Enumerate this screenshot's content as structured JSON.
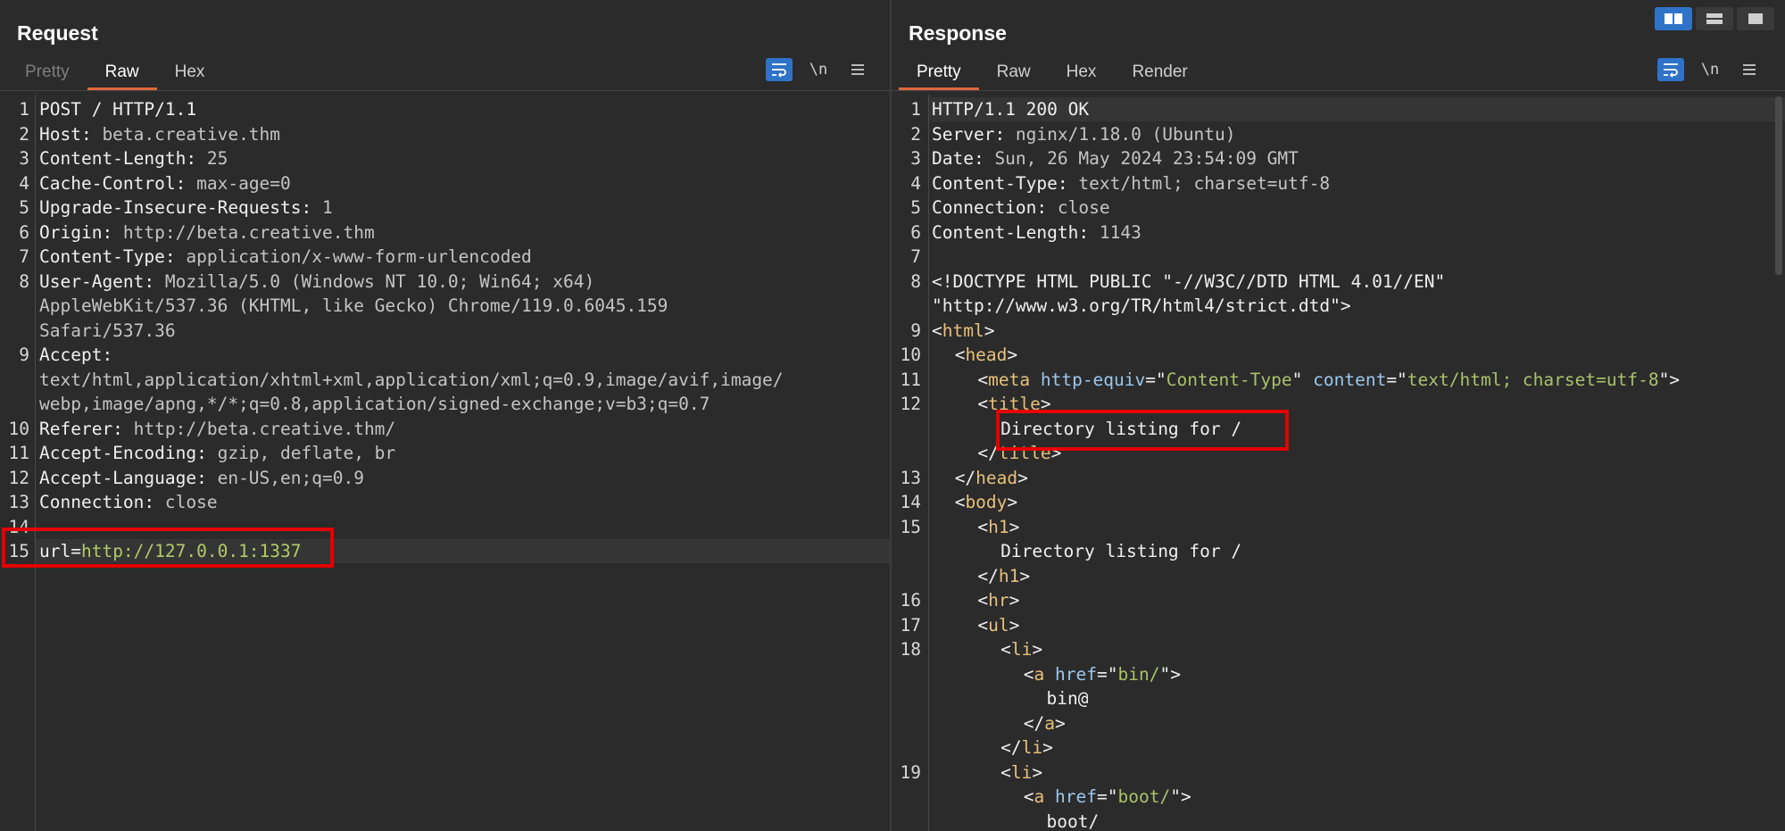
{
  "request": {
    "title": "Request",
    "tabs": [
      {
        "label": "Pretty",
        "state": "disabled"
      },
      {
        "label": "Raw",
        "state": "active"
      },
      {
        "label": "Hex",
        "state": "normal"
      }
    ],
    "tools": {
      "wrap_icon": "wrap-lines-icon",
      "newline_label": "\\n",
      "menu_icon": "hamburger-menu-icon"
    },
    "lines": [
      {
        "n": "1",
        "k": "POST / HTTP/1.1",
        "v": ""
      },
      {
        "n": "2",
        "k": "Host:",
        "v": " beta.creative.thm"
      },
      {
        "n": "3",
        "k": "Content-Length:",
        "v": " 25"
      },
      {
        "n": "4",
        "k": "Cache-Control:",
        "v": " max-age=0"
      },
      {
        "n": "5",
        "k": "Upgrade-Insecure-Requests:",
        "v": " 1"
      },
      {
        "n": "6",
        "k": "Origin:",
        "v": " http://beta.creative.thm"
      },
      {
        "n": "7",
        "k": "Content-Type:",
        "v": " application/x-www-form-urlencoded"
      },
      {
        "n": "8",
        "k": "User-Agent:",
        "v": " Mozilla/5.0 (Windows NT 10.0; Win64; x64)"
      },
      {
        "n": "",
        "k": "",
        "v": "AppleWebKit/537.36 (KHTML, like Gecko) Chrome/119.0.6045.159"
      },
      {
        "n": "",
        "k": "",
        "v": "Safari/537.36"
      },
      {
        "n": "9",
        "k": "Accept:",
        "v": ""
      },
      {
        "n": "",
        "k": "",
        "v": "text/html,application/xhtml+xml,application/xml;q=0.9,image/avif,image/"
      },
      {
        "n": "",
        "k": "",
        "v": "webp,image/apng,*/*;q=0.8,application/signed-exchange;v=b3;q=0.7"
      },
      {
        "n": "10",
        "k": "Referer:",
        "v": " http://beta.creative.thm/"
      },
      {
        "n": "11",
        "k": "Accept-Encoding:",
        "v": " gzip, deflate, br"
      },
      {
        "n": "12",
        "k": "Accept-Language:",
        "v": " en-US,en;q=0.9"
      },
      {
        "n": "13",
        "k": "Connection:",
        "v": " close"
      },
      {
        "n": "14",
        "k": "",
        "v": ""
      }
    ],
    "body_line": {
      "n": "15",
      "key": "url=",
      "value": "http://127.0.0.1:1337"
    }
  },
  "response": {
    "title": "Response",
    "tabs": [
      {
        "label": "Pretty",
        "state": "active"
      },
      {
        "label": "Raw",
        "state": "normal"
      },
      {
        "label": "Hex",
        "state": "normal"
      },
      {
        "label": "Render",
        "state": "normal"
      }
    ],
    "tools": {
      "wrap_icon": "wrap-lines-icon",
      "newline_label": "\\n",
      "menu_icon": "hamburger-menu-icon"
    },
    "layout_buttons": [
      "split-horizontal-icon",
      "split-vertical-icon",
      "single-pane-icon"
    ],
    "lines": [
      {
        "n": "1",
        "parts": [
          [
            "k",
            "HTTP/1.1 200 OK"
          ]
        ],
        "indent": 0
      },
      {
        "n": "2",
        "parts": [
          [
            "k",
            "Server:"
          ],
          [
            "v",
            " nginx/1.18.0 (Ubuntu)"
          ]
        ],
        "indent": 0
      },
      {
        "n": "3",
        "parts": [
          [
            "k",
            "Date:"
          ],
          [
            "v",
            " Sun, 26 May 2024 23:54:09 GMT"
          ]
        ],
        "indent": 0
      },
      {
        "n": "4",
        "parts": [
          [
            "k",
            "Content-Type:"
          ],
          [
            "v",
            " text/html; charset=utf-8"
          ]
        ],
        "indent": 0
      },
      {
        "n": "5",
        "parts": [
          [
            "k",
            "Connection:"
          ],
          [
            "v",
            " close"
          ]
        ],
        "indent": 0
      },
      {
        "n": "6",
        "parts": [
          [
            "k",
            "Content-Length:"
          ],
          [
            "v",
            " 1143"
          ]
        ],
        "indent": 0
      },
      {
        "n": "7",
        "parts": [],
        "indent": 0
      },
      {
        "n": "8",
        "parts": [
          [
            "k",
            "<!DOCTYPE HTML PUBLIC \"-//W3C//DTD HTML 4.01//EN\""
          ]
        ],
        "indent": 0
      },
      {
        "n": "",
        "parts": [
          [
            "k",
            "\"http://www.w3.org/TR/html4/strict.dtd\">"
          ]
        ],
        "indent": 0
      },
      {
        "n": "9",
        "parts": [
          [
            "k",
            "<"
          ],
          [
            "tag",
            "html"
          ],
          [
            "k",
            ">"
          ]
        ],
        "indent": 0
      },
      {
        "n": "10",
        "parts": [
          [
            "k",
            "<"
          ],
          [
            "tag",
            "head"
          ],
          [
            "k",
            ">"
          ]
        ],
        "indent": 1
      },
      {
        "n": "11",
        "parts": [
          [
            "k",
            "<"
          ],
          [
            "tag",
            "meta"
          ],
          [
            "k",
            " "
          ],
          [
            "attr",
            "http-equiv"
          ],
          [
            "k",
            "=\""
          ],
          [
            "str",
            "Content-Type"
          ],
          [
            "k",
            "\" "
          ],
          [
            "attr",
            "content"
          ],
          [
            "k",
            "=\""
          ],
          [
            "str",
            "text/html; charset=utf-8"
          ],
          [
            "k",
            "\">"
          ]
        ],
        "indent": 2
      },
      {
        "n": "12",
        "parts": [
          [
            "k",
            "<"
          ],
          [
            "tag",
            "title"
          ],
          [
            "k",
            ">"
          ]
        ],
        "indent": 2
      },
      {
        "n": "",
        "parts": [
          [
            "k",
            "Directory listing for /"
          ]
        ],
        "indent": 3
      },
      {
        "n": "",
        "parts": [
          [
            "k",
            "</"
          ],
          [
            "tag",
            "title"
          ],
          [
            "k",
            ">"
          ]
        ],
        "indent": 2
      },
      {
        "n": "13",
        "parts": [
          [
            "k",
            "</"
          ],
          [
            "tag",
            "head"
          ],
          [
            "k",
            ">"
          ]
        ],
        "indent": 1
      },
      {
        "n": "14",
        "parts": [
          [
            "k",
            "<"
          ],
          [
            "tag",
            "body"
          ],
          [
            "k",
            ">"
          ]
        ],
        "indent": 1
      },
      {
        "n": "15",
        "parts": [
          [
            "k",
            "<"
          ],
          [
            "tag",
            "h1"
          ],
          [
            "k",
            ">"
          ]
        ],
        "indent": 2
      },
      {
        "n": "",
        "parts": [
          [
            "k",
            "Directory listing for /"
          ]
        ],
        "indent": 3
      },
      {
        "n": "",
        "parts": [
          [
            "k",
            "</"
          ],
          [
            "tag",
            "h1"
          ],
          [
            "k",
            ">"
          ]
        ],
        "indent": 2
      },
      {
        "n": "16",
        "parts": [
          [
            "k",
            "<"
          ],
          [
            "tag",
            "hr"
          ],
          [
            "k",
            ">"
          ]
        ],
        "indent": 2
      },
      {
        "n": "17",
        "parts": [
          [
            "k",
            "<"
          ],
          [
            "tag",
            "ul"
          ],
          [
            "k",
            ">"
          ]
        ],
        "indent": 2
      },
      {
        "n": "18",
        "parts": [
          [
            "k",
            "<"
          ],
          [
            "tag",
            "li"
          ],
          [
            "k",
            ">"
          ]
        ],
        "indent": 3
      },
      {
        "n": "",
        "parts": [
          [
            "k",
            "<"
          ],
          [
            "tag",
            "a"
          ],
          [
            "k",
            " "
          ],
          [
            "attr",
            "href"
          ],
          [
            "k",
            "=\""
          ],
          [
            "str",
            "bin/"
          ],
          [
            "k",
            "\">"
          ]
        ],
        "indent": 4
      },
      {
        "n": "",
        "parts": [
          [
            "k",
            "bin@"
          ]
        ],
        "indent": 5
      },
      {
        "n": "",
        "parts": [
          [
            "k",
            "</"
          ],
          [
            "tag",
            "a"
          ],
          [
            "k",
            ">"
          ]
        ],
        "indent": 4
      },
      {
        "n": "",
        "parts": [
          [
            "k",
            "</"
          ],
          [
            "tag",
            "li"
          ],
          [
            "k",
            ">"
          ]
        ],
        "indent": 3
      },
      {
        "n": "19",
        "parts": [
          [
            "k",
            "<"
          ],
          [
            "tag",
            "li"
          ],
          [
            "k",
            ">"
          ]
        ],
        "indent": 3
      },
      {
        "n": "",
        "parts": [
          [
            "k",
            "<"
          ],
          [
            "tag",
            "a"
          ],
          [
            "k",
            " "
          ],
          [
            "attr",
            "href"
          ],
          [
            "k",
            "=\""
          ],
          [
            "str",
            "boot/"
          ],
          [
            "k",
            "\">"
          ]
        ],
        "indent": 4
      },
      {
        "n": "",
        "parts": [
          [
            "k",
            "boot/"
          ]
        ],
        "indent": 5
      }
    ]
  },
  "colors": {
    "accent": "#2f73c8",
    "active_tab_underline": "#e0663c",
    "highlight_box": "#e50000"
  }
}
